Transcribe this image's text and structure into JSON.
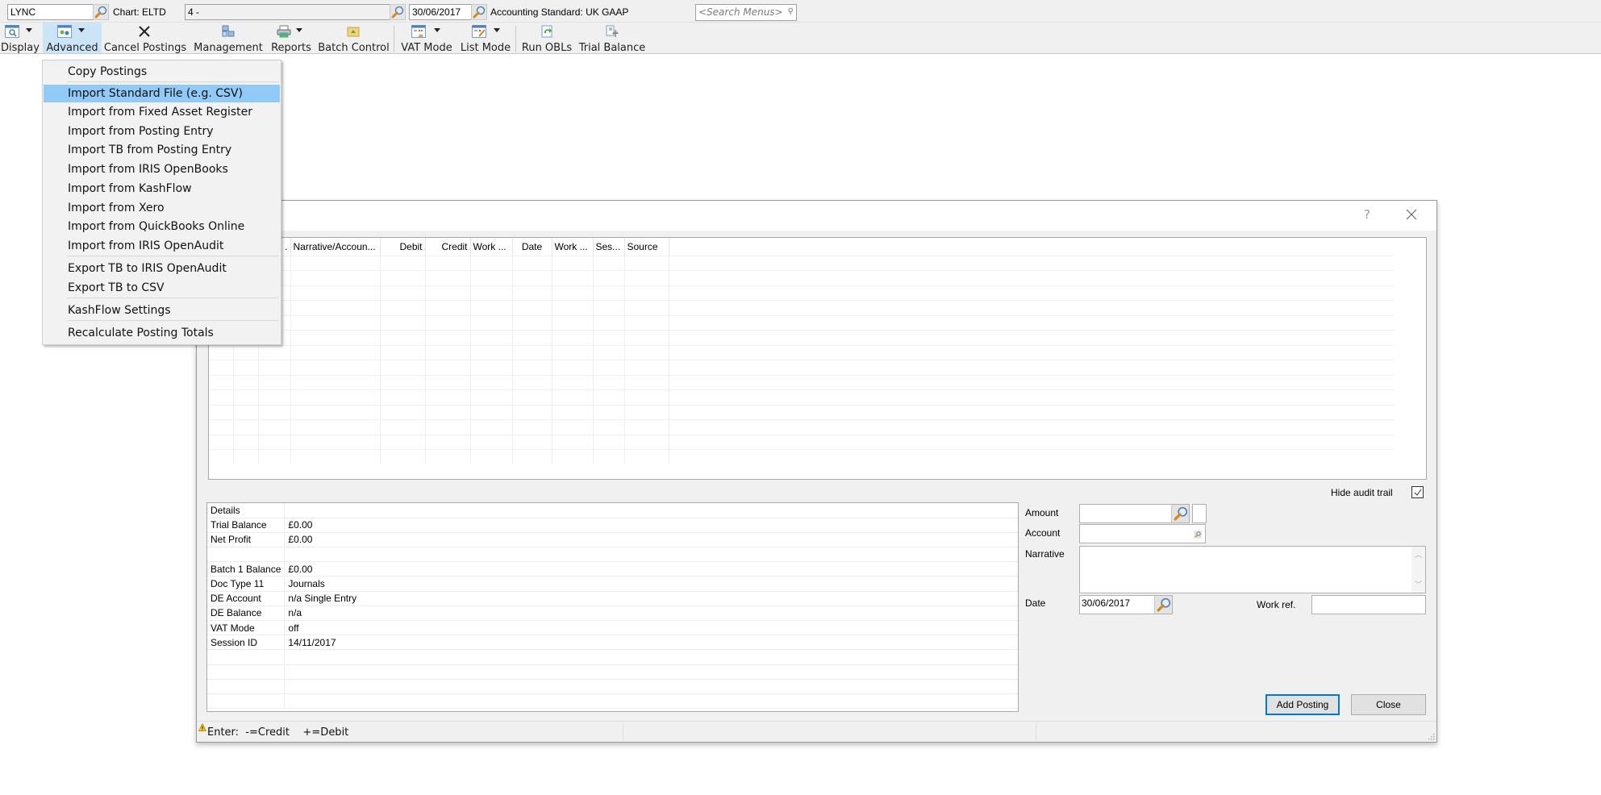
{
  "topbar": {
    "client_code": "LYNC",
    "chart_label": "Chart: ELTD",
    "period_field": "4 -",
    "date_field": "30/06/2017",
    "accounting_standard": "Accounting Standard: UK GAAP",
    "search_placeholder": "<Search Menus>"
  },
  "ribbon": {
    "buttons": [
      {
        "label": "Display",
        "icon": "display-magnifier-icon",
        "has_dropdown": true
      },
      {
        "label": "Advanced",
        "icon": "advanced-settings-icon",
        "has_dropdown": true,
        "active": true
      },
      {
        "label": "Cancel Postings",
        "icon": "x-cross-icon",
        "has_dropdown": false
      },
      {
        "label": "Management",
        "icon": "management-blocks-icon",
        "has_dropdown": false
      },
      {
        "label": "Reports",
        "icon": "printer-icon",
        "has_dropdown": true
      },
      {
        "label": "Batch Control",
        "icon": "batch-folder-icon",
        "has_dropdown": false
      },
      {
        "label": "VAT Mode",
        "icon": "vat-mode-icon",
        "has_dropdown": true
      },
      {
        "label": "List Mode",
        "icon": "list-mode-icon",
        "has_dropdown": true
      },
      {
        "label": "Run OBLs",
        "icon": "run-obls-icon",
        "has_dropdown": false
      },
      {
        "label": "Trial Balance",
        "icon": "trial-balance-scales-icon",
        "has_dropdown": false
      }
    ]
  },
  "advanced_menu": {
    "highlighted": "Import Standard File (e.g. CSV)",
    "items": [
      "Copy Postings",
      "Import Standard File (e.g. CSV)",
      "Import from Fixed Asset Register",
      "Import from Posting Entry",
      "Import TB from Posting Entry",
      "Import from IRIS OpenBooks",
      "Import from KashFlow",
      "Import from Xero",
      "Import from QuickBooks Online",
      "Import from IRIS OpenAudit",
      "Export TB to IRIS OpenAudit",
      "Export TB to CSV",
      "KashFlow Settings",
      "Recalculate Posting Totals"
    ]
  },
  "dialog": {
    "help_label": "?",
    "grid": {
      "columns": [
        "",
        "",
        ".",
        "Narrative/Accoun...",
        "Debit",
        "Credit",
        "Work ...",
        "Date",
        "Work ...",
        "Ses...",
        "Source"
      ],
      "rows": []
    },
    "hide_audit_trail": {
      "label": "Hide audit trail",
      "checked": true
    },
    "details": [
      {
        "key": "Details",
        "value": ""
      },
      {
        "key": "Trial Balance",
        "value": "£0.00"
      },
      {
        "key": "Net Profit",
        "value": "£0.00"
      },
      {
        "key": "",
        "value": ""
      },
      {
        "key": "Batch 1 Balance",
        "value": "£0.00"
      },
      {
        "key": "Doc Type 11",
        "value": "Journals"
      },
      {
        "key": "DE Account",
        "value": "n/a Single Entry"
      },
      {
        "key": "DE Balance",
        "value": "n/a"
      },
      {
        "key": "VAT Mode",
        "value": "off"
      },
      {
        "key": "Session ID",
        "value": "14/11/2017"
      }
    ],
    "form": {
      "amount_label": "Amount",
      "amount_value": "",
      "account_label": "Account",
      "account_value": "",
      "narrative_label": "Narrative",
      "narrative_value": "",
      "date_label": "Date",
      "date_value": "30/06/2017",
      "workref_label": "Work ref.",
      "workref_value": ""
    },
    "buttons": {
      "add_posting": "Add Posting",
      "close": "Close"
    },
    "status": {
      "text": "Enter:  -=Credit    +=Debit"
    }
  }
}
